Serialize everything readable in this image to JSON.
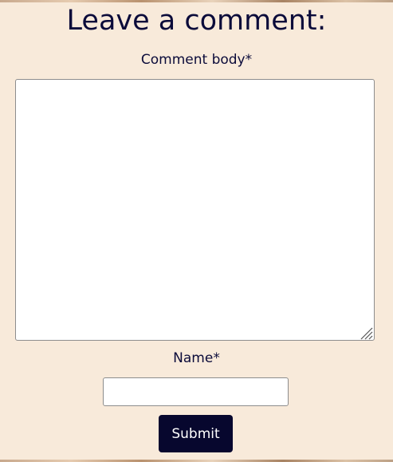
{
  "form": {
    "title": "Leave a comment:",
    "body_label": "Comment body*",
    "body_value": "",
    "name_label": "Name*",
    "name_value": "",
    "submit_label": "Submit"
  },
  "colors": {
    "background": "#f8eada",
    "text": "#0b0b3a",
    "button": "#07072e",
    "button_text": "#ffffff"
  }
}
